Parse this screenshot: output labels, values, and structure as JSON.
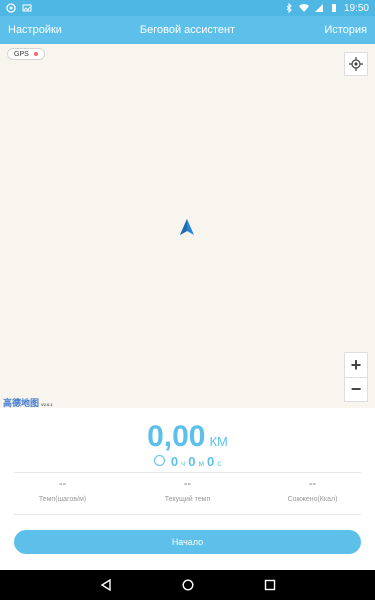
{
  "statusbar": {
    "time": "19:50",
    "icons": [
      "sync-icon",
      "image-icon",
      "bluetooth-icon",
      "wifi-icon",
      "signal-icon",
      "battery-icon"
    ]
  },
  "appbar": {
    "left_label": "Настройки",
    "title": "Беговой ассистент",
    "right_label": "История"
  },
  "map": {
    "gps_label": "GPS",
    "gps_status_color": "#f06a6a",
    "zoom_in": "+",
    "zoom_out": "−",
    "logo_text": "高德地图",
    "logo_version": "V2.0.1"
  },
  "panel": {
    "distance_value": "0,00",
    "distance_unit": "КМ",
    "timer": {
      "hours": "0",
      "h_label": "ч",
      "minutes": "0",
      "m_label": "м",
      "seconds": "0",
      "s_label": "с"
    },
    "stats": [
      {
        "value": "--",
        "label": "Темп(шагов/м)"
      },
      {
        "value": "--",
        "label": "Текущий темп"
      },
      {
        "value": "--",
        "label": "Сожжено(Ккал)"
      }
    ],
    "start_label": "Начало"
  },
  "colors": {
    "accent": "#5cc0ea",
    "map_bg": "#f8f5ee"
  }
}
